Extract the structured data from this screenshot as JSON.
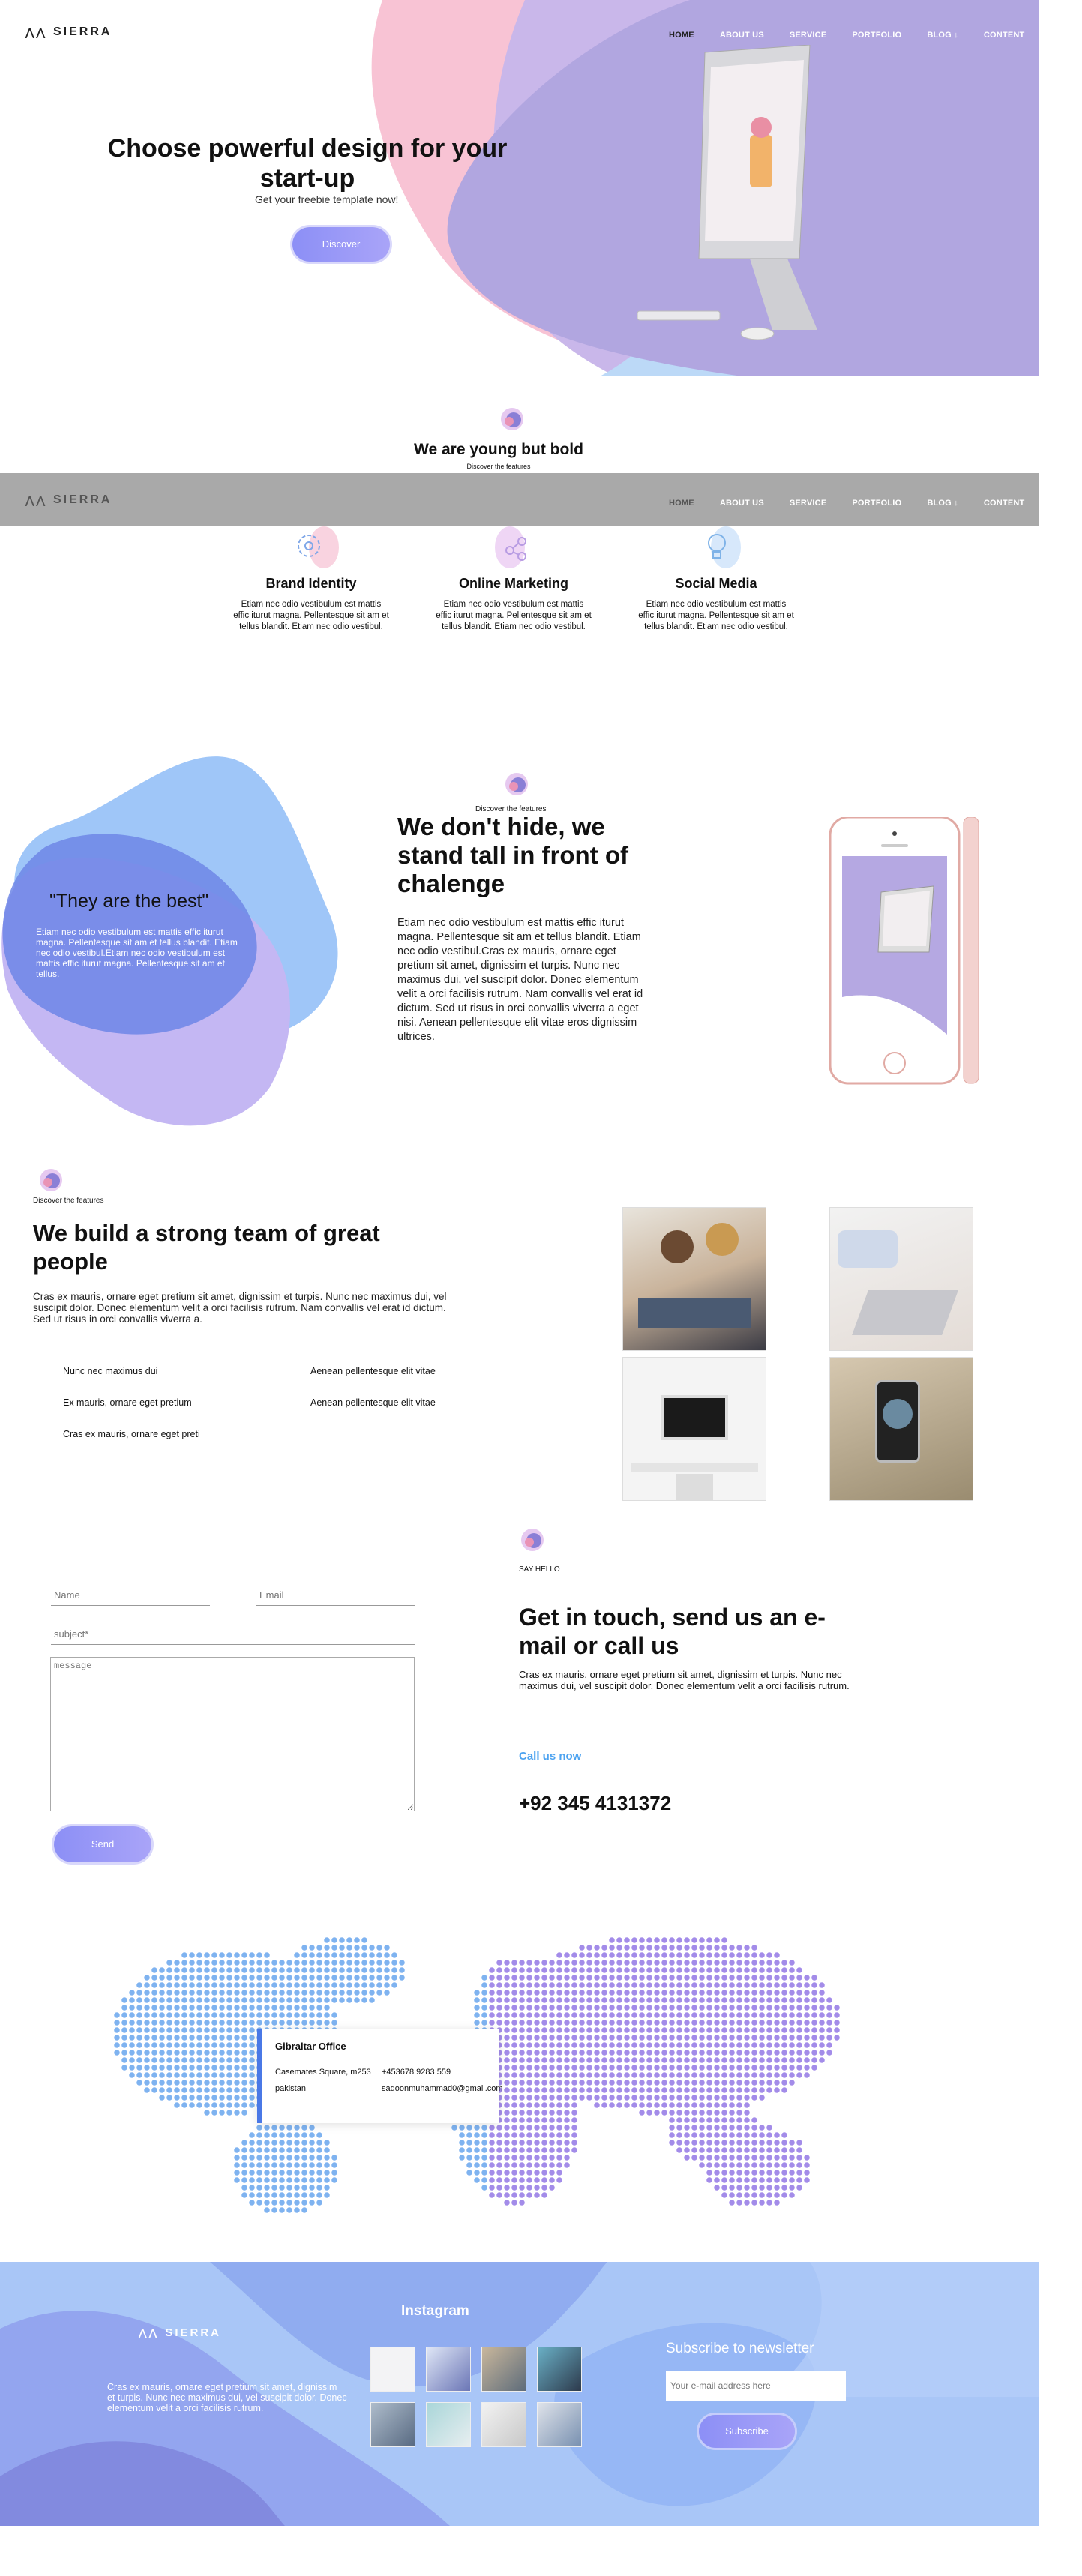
{
  "brand": {
    "name": "SIERRA"
  },
  "nav": {
    "items": [
      "HOME",
      "ABOUT US",
      "SERVICE",
      "PORTFOLIO",
      "BLOG ↓",
      "CONTENT"
    ]
  },
  "hero": {
    "title": "Choose powerful design for your start-up",
    "subtitle": "Get your freebie template now!",
    "cta": "Discover"
  },
  "about": {
    "title": "We are young but bold",
    "subtitle": "Discover the features",
    "cards": [
      {
        "title": "Brand Identity",
        "text": "Etiam nec odio vestibulum est mattis effic iturut magna. Pellentesque sit am et tellus blandit. Etiam nec odio vestibul.",
        "icon": "gear-icon"
      },
      {
        "title": "Online Marketing",
        "text": "Etiam nec odio vestibulum est mattis effic iturut magna. Pellentesque sit am et tellus blandit. Etiam nec odio vestibul.",
        "icon": "share-icon"
      },
      {
        "title": "Social Media",
        "text": "Etiam nec odio vestibulum est mattis effic iturut magna. Pellentesque sit am et tellus blandit. Etiam nec odio vestibul.",
        "icon": "bulb-icon"
      }
    ]
  },
  "features": {
    "quote": "\"They are the best\"",
    "quote_text": "Etiam nec odio vestibulum est mattis effic iturut magna. Pellentesque sit am et tellus blandit. Etiam nec odio vestibul.Etiam nec odio vestibulum est mattis effic iturut magna. Pellentesque sit am et tellus.",
    "eyebrow": "Discover the features",
    "title": "We don't hide, we stand tall in front of chalenge",
    "text": "Etiam nec odio vestibulum est mattis effic iturut magna. Pellentesque sit am et tellus blandit. Etiam nec odio vestibul.Cras ex mauris, ornare eget pretium sit amet, dignissim et turpis. Nunc nec maximus dui, vel suscipit dolor. Donec elementum velit a orci facilisis rutrum. Nam convallis vel erat id dictum. Sed ut risus in orci convallis viverra a eget nisi. Aenean pellentesque elit vitae eros dignissim ultrices."
  },
  "team": {
    "eyebrow": "Discover the features",
    "title": "We build a strong team of great people",
    "text": "Cras ex mauris, ornare eget pretium sit amet, dignissim et turpis. Nunc nec maximus dui, vel suscipit dolor. Donec elementum velit a orci facilisis rutrum. Nam convallis vel erat id dictum. Sed ut risus in orci convallis viverra a.",
    "list_left": [
      "Nunc nec maximus dui",
      "Ex mauris, ornare eget pretium",
      "Cras ex mauris, ornare eget preti"
    ],
    "list_right": [
      "Aenean pellentesque elit vitae",
      "Aenean pellentesque elit vitae"
    ]
  },
  "contact": {
    "name_placeholder": "Name",
    "email_placeholder": "Email",
    "subject_placeholder": "subject*",
    "message_placeholder": "message",
    "send": "Send",
    "eyebrow": "SAY HELLO",
    "title": "Get in touch, send us an e-mail or call us",
    "text": "Cras ex mauris, ornare eget pretium sit amet, dignissim et turpis. Nunc nec maximus dui, vel suscipit dolor. Donec elementum velit a orci facilisis rutrum.",
    "call_label": "Call us now",
    "phone": "+92 345 4131372"
  },
  "office": {
    "title": "Gibraltar Office",
    "address": "Casemates Square, m253",
    "country": "pakistan",
    "phone": "+453678 9283 559",
    "email": "sadoonmuhammad0@gmail.com"
  },
  "footer": {
    "about": "Cras ex mauris, ornare eget pretium sit amet, dignissim et turpis. Nunc nec maximus dui, vel suscipit dolor. Donec elementum velit a orci facilisis rutrum.",
    "instagram": "Instagram",
    "newsletter": "Subscribe to newsletter",
    "newsletter_placeholder": "Your e-mail address here",
    "subscribe": "Subscribe"
  },
  "colors": {
    "accent": "#8c8ff6",
    "lavender": "#b1a6e0",
    "pink": "#f8c7d6",
    "footer": "#a9c6f7",
    "link": "#4da3f0"
  }
}
